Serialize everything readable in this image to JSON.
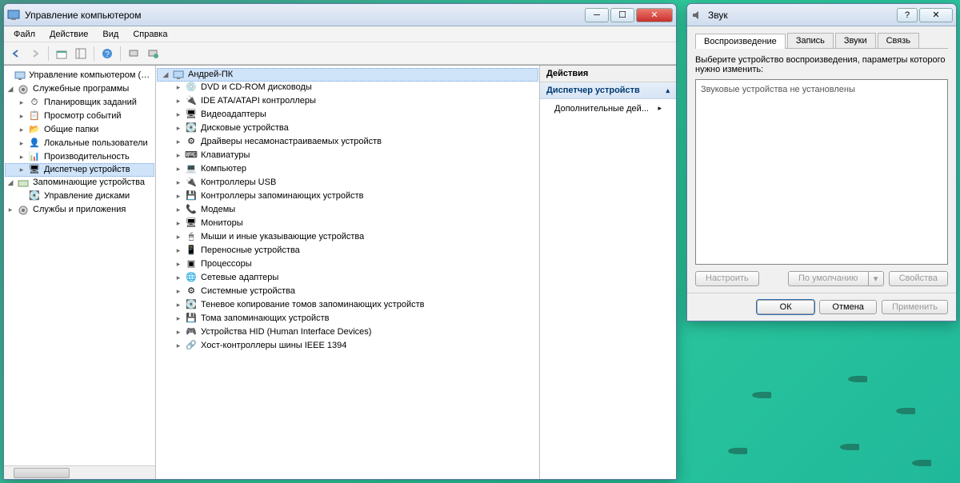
{
  "main": {
    "title": "Управление компьютером",
    "menu": [
      "Файл",
      "Действие",
      "Вид",
      "Справка"
    ],
    "left_tree": {
      "root": "Управление компьютером (локальным)",
      "groups": [
        {
          "label": "Служебные программы",
          "children": [
            "Планировщик заданий",
            "Просмотр событий",
            "Общие папки",
            "Локальные пользователи",
            "Производительность",
            "Диспетчер устройств"
          ],
          "selected_index": 5
        },
        {
          "label": "Запоминающие устройства",
          "children": [
            "Управление дисками"
          ]
        },
        {
          "label": "Службы и приложения",
          "children": []
        }
      ]
    },
    "device_root": "Андрей-ПК",
    "devices": [
      "DVD и CD-ROM дисководы",
      "IDE ATA/ATAPI контроллеры",
      "Видеоадаптеры",
      "Дисковые устройства",
      "Драйверы несамонастраиваемых устройств",
      "Клавиатуры",
      "Компьютер",
      "Контроллеры USB",
      "Контроллеры запоминающих устройств",
      "Модемы",
      "Мониторы",
      "Мыши и иные указывающие устройства",
      "Переносные устройства",
      "Процессоры",
      "Сетевые адаптеры",
      "Системные устройства",
      "Теневое копирование томов запоминающих устройств",
      "Тома запоминающих устройств",
      "Устройства HID (Human Interface Devices)",
      "Хост-контроллеры шины IEEE 1394"
    ],
    "actions": {
      "header": "Действия",
      "subheader": "Диспетчер устройств",
      "more": "Дополнительные дей..."
    }
  },
  "sound": {
    "title": "Звук",
    "tabs": [
      "Воспроизведение",
      "Запись",
      "Звуки",
      "Связь"
    ],
    "active_tab": 0,
    "instruction": "Выберите устройство воспроизведения, параметры которого нужно изменить:",
    "empty_text": "Звуковые устройства не установлены",
    "btn_configure": "Настроить",
    "btn_default": "По умолчанию",
    "btn_properties": "Свойства",
    "btn_ok": "ОК",
    "btn_cancel": "Отмена",
    "btn_apply": "Применить"
  }
}
